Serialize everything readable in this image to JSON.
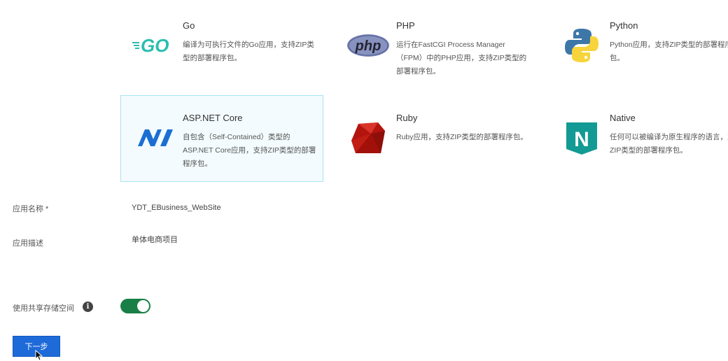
{
  "runtimes": [
    {
      "name": "Go",
      "desc": "编译为可执行文件的Go应用，支持ZIP类型的部署程序包。",
      "icon": "go-logo-icon"
    },
    {
      "name": "PHP",
      "desc": "运行在FastCGI Process Manager（FPM）中的PHP应用，支持ZIP类型的部署程序包。",
      "icon": "php-logo-icon"
    },
    {
      "name": "Python",
      "desc": "Python应用，支持ZIP类型的部署程序包。",
      "icon": "python-logo-icon"
    },
    {
      "name": "ASP.NET Core",
      "desc": "自包含（Self-Contained）类型的ASP.NET Core应用，支持ZIP类型的部署程序包。",
      "icon": "dotnet-logo-icon",
      "selected": true
    },
    {
      "name": "Ruby",
      "desc": "Ruby应用，支持ZIP类型的部署程序包。",
      "icon": "ruby-logo-icon"
    },
    {
      "name": "Native",
      "desc": "任何可以被编译为原生程序的语言，支持ZIP类型的部署程序包。",
      "icon": "native-logo-icon"
    }
  ],
  "logos": {
    "go": "GO",
    "php": "php",
    "native": "N"
  },
  "form": {
    "app_name_label": "应用名称 *",
    "app_name_value": "YDT_EBusiness_WebSite",
    "app_desc_label": "应用描述",
    "app_desc_value": "单体电商项目",
    "shared_storage_label": "使用共享存储空间",
    "shared_storage_enabled": true
  },
  "actions": {
    "next_label": "下一步"
  },
  "colors": {
    "primary": "#1e6ad8",
    "toggle_on": "#1a7f46",
    "selected_bg": "#f3fbfe",
    "selected_border": "#a9e2f4"
  }
}
